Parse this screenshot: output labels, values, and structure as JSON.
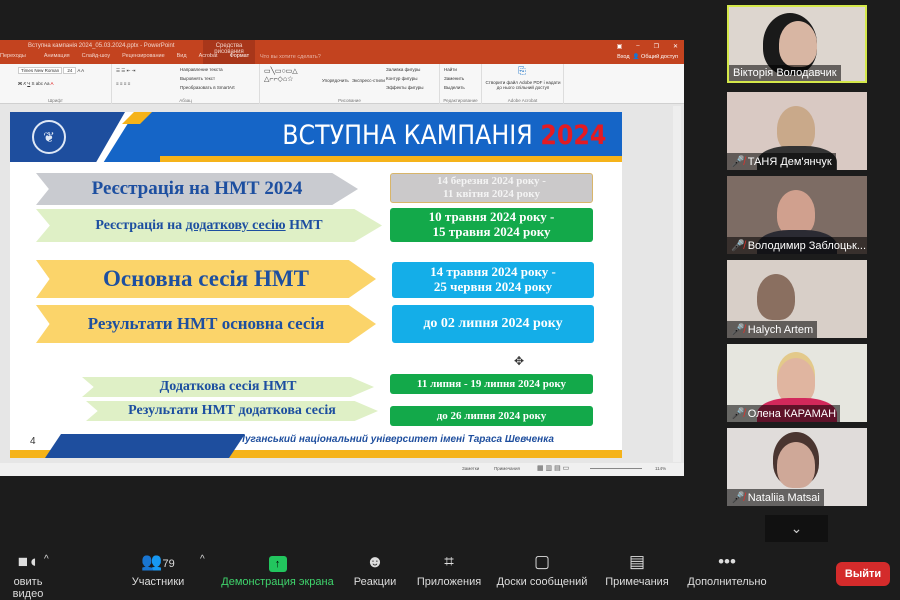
{
  "ppt": {
    "title": "Вступна кампанія 2024_05.03.2024.pptx - PowerPoint",
    "context_group": "Средства рисования",
    "tabs": [
      "Переходы",
      "Анимация",
      "Слайд-шоу",
      "Рецензирование",
      "Вид",
      "Acrobat"
    ],
    "context_tab": "Формат",
    "search_placeholder": "Что вы хотите сделать?",
    "signin": "Вход",
    "share": "Общий доступ",
    "ribbon": {
      "font_name": "Times New Roman",
      "font_size": "24",
      "group_font": "Шрифт",
      "group_paragraph": "Абзац",
      "text_dir": "Направление текста",
      "align_text": "Выровнять текст",
      "smartart": "Преобразовать в SmartArt",
      "group_drawing": "Рисование",
      "arrange": "Упорядочить",
      "quick_styles": "Экспресс-стили",
      "fill": "Заливка фигуры",
      "outline": "Контур фигуры",
      "effects": "Эффекты фигуры",
      "find": "Найти",
      "replace": "Заменить",
      "select": "Выделить",
      "group_edit": "Редактирование",
      "acrobat_btn": "Створити файл Adobe PDF і надати до нього спільний доступ",
      "group_acrobat": "Adobe Acrobat"
    },
    "status": {
      "notes": "Заметки",
      "comments": "Примечания",
      "zoom": "114%"
    }
  },
  "slide": {
    "title": "ВСТУПНА КАМПАНІЯ",
    "year": "2024",
    "page": "4",
    "footer": "Луганський національний університет імені Тараса Шевченка",
    "rows": [
      {
        "label": "Реєстрація на НМТ 2024",
        "date1": "14 березня 2024 року -",
        "date2": "11 квітня 2024 року"
      },
      {
        "label_a": "Реєстрація на ",
        "label_u": "додаткову сесію ",
        "label_b": "НМТ",
        "date1": "10 травня 2024 року -",
        "date2": "15 травня 2024 року"
      },
      {
        "label": "Основна сесія НМТ",
        "date1": "14 травня 2024 року -",
        "date2": "25 червня 2024 року"
      },
      {
        "label": "Результати НМТ основна сесія",
        "date1": "до 02 липня 2024 року"
      },
      {
        "label": "Додаткова сесія НМТ",
        "date1": "11 липня - 19 липня 2024 року"
      },
      {
        "label": "Результати НМТ додаткова сесія",
        "date1": "до 26 липня 2024 року"
      }
    ]
  },
  "participants": [
    "Вікторія Володавчик",
    "ТАНЯ Дем'янчук",
    "Володимир Заблоцьк...",
    "Halych Artem",
    "Олена КАРАМАН",
    "Nataliia Matsai"
  ],
  "toolbar": {
    "video": "овить видео",
    "participants": "Участники",
    "participants_count": "79",
    "share": "Демонстрация экрана",
    "reactions": "Реакции",
    "apps": "Приложения",
    "whiteboards": "Доски сообщений",
    "notes": "Примечания",
    "more": "Дополнительно",
    "leave": "Выйти"
  },
  "colors": {
    "ppt_red": "#c3431f",
    "slide_blue": "#1565c7",
    "accent_yellow": "#f5b31a",
    "green": "#13a94a",
    "cyan": "#14aee8",
    "share_green": "#22c55e",
    "leave_red": "#d42b2b"
  }
}
